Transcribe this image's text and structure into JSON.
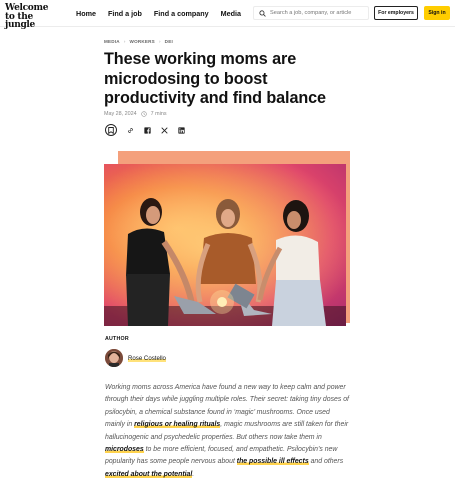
{
  "brand": {
    "line1": "Welcome",
    "line2": "to the jungle",
    "accent": "#ffcd00"
  },
  "nav": [
    {
      "label": "Home"
    },
    {
      "label": "Find a job"
    },
    {
      "label": "Find a company"
    },
    {
      "label": "Media"
    }
  ],
  "search": {
    "placeholder": "Search a job, company, or article",
    "icon": "search-icon"
  },
  "header_buttons": {
    "employers": "For employers",
    "signin": "Sign in"
  },
  "breadcrumb": [
    "MEDIA",
    "WORKERS",
    "DEI"
  ],
  "article": {
    "title": "These working moms are microdosing to boost productivity and find balance",
    "date": "May 28, 2024",
    "read_time": "7 mins",
    "share_icons": [
      "bookmark-icon",
      "link-icon",
      "facebook-icon",
      "x-icon",
      "linkedin-icon"
    ]
  },
  "author": {
    "label": "AUTHOR",
    "name": "Rose Costello"
  },
  "body": {
    "p1": "Working moms across America have found a new way to keep calm and power through their days while juggling multiple roles. Their secret: taking tiny doses of psilocybin, a chemical substance found in ‘magic’ mushrooms. Once used mainly in ",
    "l1": "religious or healing rituals",
    "p2": ", magic mushrooms are still taken for their hallucinogenic and psychedelic properties. But others now take them in ",
    "l2": "microdoses",
    "p3": " to be more efficient, focused, and empathetic. Psilocybin’s new popularity has some people nervous about ",
    "l3": "the possible ill effects",
    "p4": " and others ",
    "l4": "excited about the potential",
    "p5": "."
  }
}
